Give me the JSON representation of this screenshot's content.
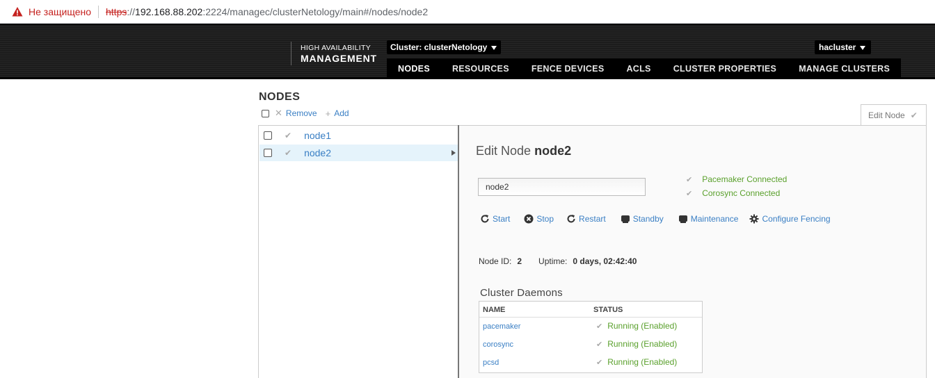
{
  "browser": {
    "insecure_label": "Не защищено",
    "url_scheme": "https",
    "url_colon": "://",
    "url_host": "192.168.88.202",
    "url_path": ":2224/managec/clusterNetology/main#/nodes/node2"
  },
  "header": {
    "logo_line1": "HIGH AVAILABILITY",
    "logo_line2": "MANAGEMENT",
    "cluster_selector": "Cluster: clusterNetology",
    "user_menu": "hacluster",
    "nav": [
      "NODES",
      "RESOURCES",
      "FENCE DEVICES",
      "ACLS",
      "CLUSTER PROPERTIES",
      "MANAGE CLUSTERS"
    ],
    "active_nav": "NODES"
  },
  "nodes_page": {
    "title": "NODES",
    "remove_label": "Remove",
    "add_label": "Add",
    "edit_tab_label": "Edit Node",
    "nodes": [
      {
        "name": "node1",
        "selected": false
      },
      {
        "name": "node2",
        "selected": true
      }
    ]
  },
  "edit_node": {
    "heading_prefix": "Edit Node",
    "heading_name": "node2",
    "name_value": "node2",
    "status": [
      "Pacemaker Connected",
      "Corosync Connected"
    ],
    "actions": [
      "Start",
      "Stop",
      "Restart",
      "Standby",
      "Maintenance",
      "Configure Fencing"
    ],
    "node_id_label": "Node ID:",
    "node_id": "2",
    "uptime_label": "Uptime:",
    "uptime": "0 days, 02:42:40",
    "daemons_title": "Cluster Daemons",
    "daemons_header": {
      "name": "NAME",
      "status": "STATUS"
    },
    "daemons": [
      {
        "name": "pacemaker",
        "status": "Running (Enabled)"
      },
      {
        "name": "corosync",
        "status": "Running (Enabled)"
      },
      {
        "name": "pcsd",
        "status": "Running (Enabled)"
      }
    ]
  },
  "colors": {
    "link": "#3a7fc4",
    "ok": "#5aa02c",
    "insecure": "#c5221f",
    "header_bg": "#1c1c1c",
    "selected_row": "#e5f3fb"
  }
}
